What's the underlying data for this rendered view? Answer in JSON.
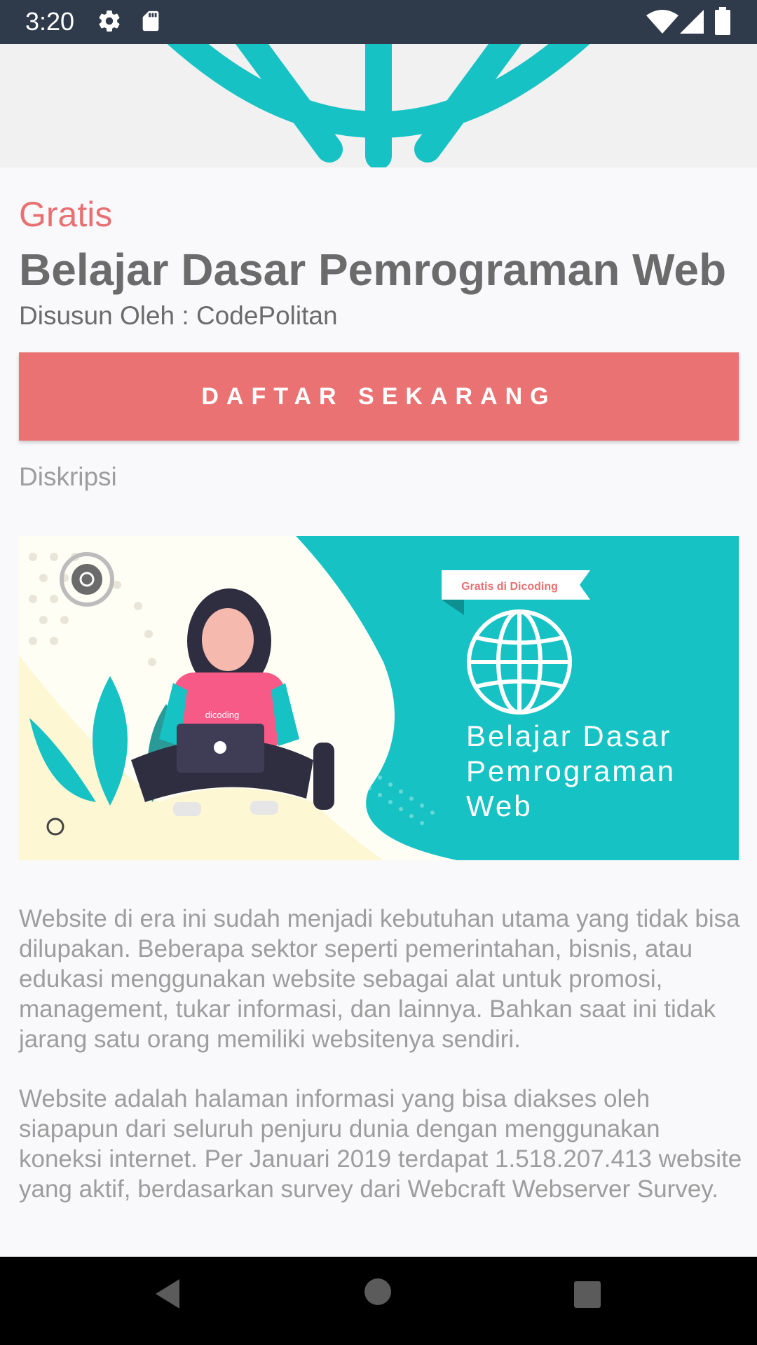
{
  "status_bar": {
    "time": "3:20",
    "icons": [
      "settings-icon",
      "sd-card-icon",
      "wifi-icon",
      "signal-icon",
      "battery-icon"
    ]
  },
  "course": {
    "price_label": "Gratis",
    "title": "Belajar Dasar Pemrograman Web",
    "author": "Disusun Oleh : CodePolitan",
    "register_button": "DAFTAR SEKARANG",
    "description_label": "Diskripsi"
  },
  "banner": {
    "ribbon_text": "Gratis di Dicoding",
    "title_lines": [
      "Belajar Dasar",
      "Pemrograman",
      "Web"
    ],
    "laptop_sticker": "dicoding"
  },
  "description": {
    "paragraph_1": "Website di era ini sudah menjadi kebutuhan utama yang tidak bisa dilupakan. Beberapa sektor seperti pemerintahan, bisnis, atau edukasi menggunakan website sebagai alat untuk promosi, management, tukar informasi, dan lainnya. Bahkan saat ini tidak jarang satu orang memiliki websitenya sendiri.",
    "paragraph_2": "Website adalah halaman informasi yang bisa diakses oleh siapapun dari seluruh penjuru dunia dengan menggunakan koneksi internet. Per Januari 2019 terdapat 1.518.207.413 website yang aktif, berdasarkan survey dari Webcraft Webserver Survey."
  },
  "navigation": {
    "icons": [
      "back-icon",
      "home-icon",
      "recents-icon"
    ]
  },
  "colors": {
    "status_bar": "#2f3a4b",
    "accent": "#ea7273",
    "teal": "#17c2c4",
    "text_dark": "#6b6b6b",
    "text_light": "#9d9d9d"
  }
}
